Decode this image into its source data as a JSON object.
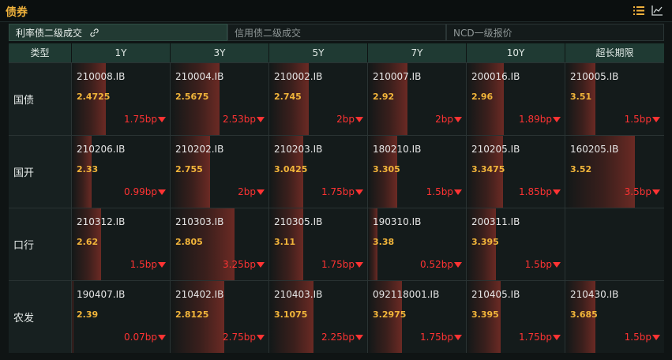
{
  "header": {
    "title": "债券",
    "icons": [
      "list-icon",
      "line-chart-icon"
    ]
  },
  "tabs": [
    {
      "label": "利率债二级成交",
      "active": true
    },
    {
      "label": "信用债二级成交",
      "active": false
    },
    {
      "label": "NCD一级报价",
      "active": false
    }
  ],
  "columns": [
    "类型",
    "1Y",
    "3Y",
    "5Y",
    "7Y",
    "10Y",
    "超长期限"
  ],
  "rows": [
    {
      "label": "国债",
      "cells": [
        {
          "code": "210008.IB",
          "yield": "2.4725",
          "change": "1.75bp",
          "level": 0.35
        },
        {
          "code": "210004.IB",
          "yield": "2.5675",
          "change": "2.53bp",
          "level": 0.5
        },
        {
          "code": "210002.IB",
          "yield": "2.745",
          "change": "2bp",
          "level": 0.4
        },
        {
          "code": "210007.IB",
          "yield": "2.92",
          "change": "2bp",
          "level": 0.4
        },
        {
          "code": "200016.IB",
          "yield": "2.96",
          "change": "1.89bp",
          "level": 0.38
        },
        {
          "code": "210005.IB",
          "yield": "3.51",
          "change": "1.5bp",
          "level": 0.3
        }
      ]
    },
    {
      "label": "国开",
      "cells": [
        {
          "code": "210206.IB",
          "yield": "2.33",
          "change": "0.99bp",
          "level": 0.2
        },
        {
          "code": "210202.IB",
          "yield": "2.755",
          "change": "2bp",
          "level": 0.4
        },
        {
          "code": "210203.IB",
          "yield": "3.0425",
          "change": "1.75bp",
          "level": 0.35
        },
        {
          "code": "180210.IB",
          "yield": "3.305",
          "change": "1.5bp",
          "level": 0.3
        },
        {
          "code": "210205.IB",
          "yield": "3.3475",
          "change": "1.85bp",
          "level": 0.37
        },
        {
          "code": "160205.IB",
          "yield": "3.52",
          "change": "3.5bp",
          "level": 0.7
        }
      ]
    },
    {
      "label": "口行",
      "cells": [
        {
          "code": "210312.IB",
          "yield": "2.62",
          "change": "1.5bp",
          "level": 0.3
        },
        {
          "code": "210303.IB",
          "yield": "2.805",
          "change": "3.25bp",
          "level": 0.65
        },
        {
          "code": "210305.IB",
          "yield": "3.11",
          "change": "1.75bp",
          "level": 0.35
        },
        {
          "code": "190310.IB",
          "yield": "3.38",
          "change": "0.52bp",
          "level": 0.1
        },
        {
          "code": "200311.IB",
          "yield": "3.395",
          "change": "1.5bp",
          "level": 0.3
        },
        {
          "code": "",
          "yield": "",
          "change": "",
          "level": 0
        }
      ]
    },
    {
      "label": "农发",
      "cells": [
        {
          "code": "190407.IB",
          "yield": "2.39",
          "change": "0.07bp",
          "level": 0.02
        },
        {
          "code": "210402.IB",
          "yield": "2.8125",
          "change": "2.75bp",
          "level": 0.55
        },
        {
          "code": "210403.IB",
          "yield": "3.1075",
          "change": "2.25bp",
          "level": 0.45
        },
        {
          "code": "092118001.IB",
          "yield": "3.2975",
          "change": "1.75bp",
          "level": 0.35
        },
        {
          "code": "210405.IB",
          "yield": "3.395",
          "change": "1.75bp",
          "level": 0.35
        },
        {
          "code": "210430.IB",
          "yield": "3.685",
          "change": "1.5bp",
          "level": 0.3
        }
      ]
    }
  ],
  "colors": {
    "accent": "#f0b23c",
    "down": "#ff3333",
    "header_bg": "#1f3a33"
  }
}
